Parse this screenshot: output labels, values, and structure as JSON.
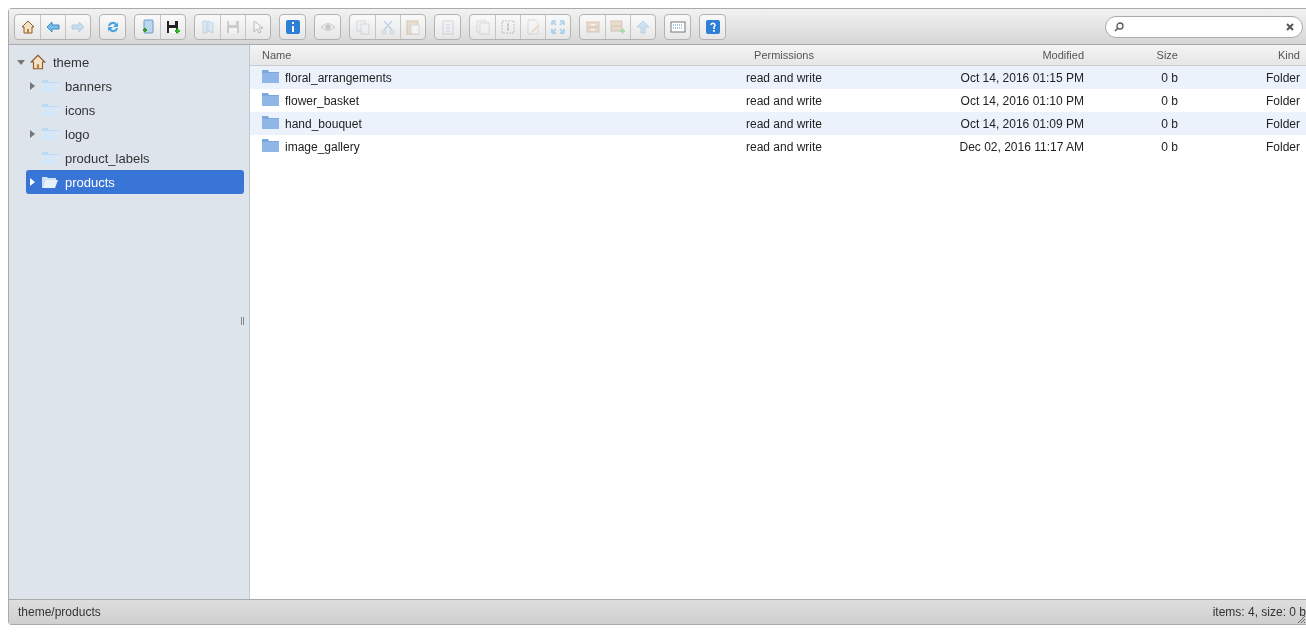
{
  "toolbar": [
    {
      "buttons": [
        {
          "kind": "home",
          "disabled": false
        },
        {
          "kind": "back",
          "disabled": false
        },
        {
          "kind": "forward",
          "disabled": true
        }
      ]
    },
    {
      "buttons": [
        {
          "kind": "reload",
          "disabled": false
        }
      ]
    },
    {
      "buttons": [
        {
          "kind": "newfolder",
          "disabled": false
        },
        {
          "kind": "upload",
          "disabled": false
        }
      ]
    },
    {
      "buttons": [
        {
          "kind": "open",
          "disabled": true
        },
        {
          "kind": "save",
          "disabled": true
        },
        {
          "kind": "pointer",
          "disabled": true
        }
      ]
    },
    {
      "buttons": [
        {
          "kind": "info",
          "disabled": false
        }
      ]
    },
    {
      "buttons": [
        {
          "kind": "preview",
          "disabled": true
        }
      ]
    },
    {
      "buttons": [
        {
          "kind": "copy",
          "disabled": true
        },
        {
          "kind": "cut",
          "disabled": true
        },
        {
          "kind": "paste",
          "disabled": true
        }
      ]
    },
    {
      "buttons": [
        {
          "kind": "clipboard",
          "disabled": true
        }
      ]
    },
    {
      "buttons": [
        {
          "kind": "duplicate",
          "disabled": true
        },
        {
          "kind": "rename",
          "disabled": true
        },
        {
          "kind": "edit",
          "disabled": true
        },
        {
          "kind": "resize",
          "disabled": true
        }
      ]
    },
    {
      "buttons": [
        {
          "kind": "archive",
          "disabled": true
        },
        {
          "kind": "extract",
          "disabled": true
        },
        {
          "kind": "up",
          "disabled": true
        }
      ]
    },
    {
      "buttons": [
        {
          "kind": "view",
          "disabled": false
        }
      ]
    },
    {
      "buttons": [
        {
          "kind": "help",
          "disabled": false
        }
      ]
    }
  ],
  "tree": {
    "label": "theme",
    "expanded": true,
    "children": [
      {
        "label": "banners",
        "expandable": true,
        "selected": false
      },
      {
        "label": "icons",
        "expandable": false,
        "selected": false
      },
      {
        "label": "logo",
        "expandable": true,
        "selected": false
      },
      {
        "label": "product_labels",
        "expandable": false,
        "selected": false
      },
      {
        "label": "products",
        "expandable": true,
        "selected": true
      }
    ]
  },
  "table": {
    "columns": [
      "Name",
      "Permissions",
      "Modified",
      "Size",
      "Kind"
    ],
    "rows": [
      [
        "floral_arrangements",
        "read and write",
        "Oct 14, 2016 01:15 PM",
        "0 b",
        "Folder"
      ],
      [
        "flower_basket",
        "read and write",
        "Oct 14, 2016 01:10 PM",
        "0 b",
        "Folder"
      ],
      [
        "hand_bouquet",
        "read and write",
        "Oct 14, 2016 01:09 PM",
        "0 b",
        "Folder"
      ],
      [
        "image_gallery",
        "read and write",
        "Dec 02, 2016 11:17 AM",
        "0 b",
        "Folder"
      ]
    ]
  },
  "status_bar": {
    "path": "theme/products",
    "summary": "items: 4, size: 0 b"
  }
}
